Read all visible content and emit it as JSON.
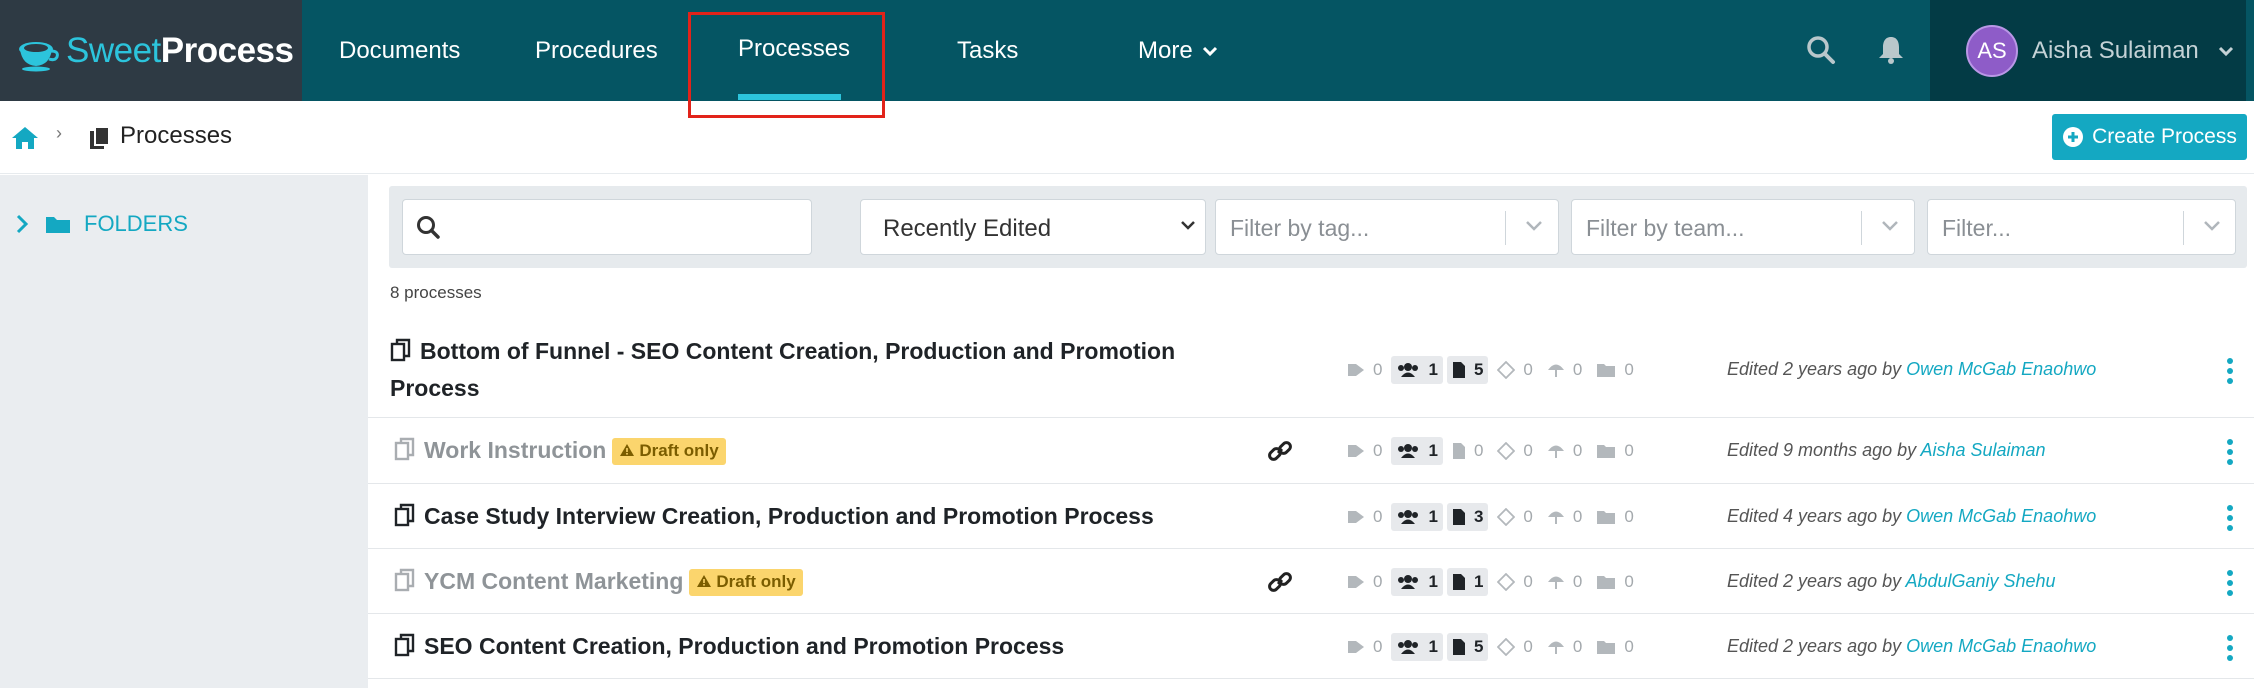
{
  "brand": {
    "sweet": "Sweet",
    "process": "Process"
  },
  "nav": {
    "documents": "Documents",
    "procedures": "Procedures",
    "processes": "Processes",
    "tasks": "Tasks",
    "more": "More"
  },
  "user": {
    "initials": "AS",
    "name": "Aisha Sulaiman"
  },
  "breadcrumb": {
    "current": "Processes"
  },
  "actions": {
    "create_process": "Create Process"
  },
  "sidebar": {
    "folders_label": "FOLDERS"
  },
  "filters": {
    "search_placeholder": "",
    "sort_value": "Recently Edited",
    "tag_placeholder": "Filter by tag...",
    "team_placeholder": "Filter by team...",
    "generic_placeholder": "Filter..."
  },
  "list": {
    "count_text": "8 processes",
    "draft_label": "Draft only",
    "rows": [
      {
        "title": "Bottom of Funnel - SEO Content Creation, Production and Promotion Process",
        "draft": false,
        "stats": {
          "tags": "0",
          "members": "1",
          "docs": "5",
          "approvals": "0",
          "uploads": "0",
          "folders": "0"
        },
        "edited_prefix": "Edited 2 years ago by ",
        "editor": "Owen McGab Enaohwo"
      },
      {
        "title": "Work Instruction",
        "draft": true,
        "stats": {
          "tags": "0",
          "members": "1",
          "docs": "0",
          "approvals": "0",
          "uploads": "0",
          "folders": "0"
        },
        "edited_prefix": "Edited 9 months ago by ",
        "editor": "Aisha Sulaiman"
      },
      {
        "title": "Case Study Interview Creation, Production and Promotion Process",
        "draft": false,
        "stats": {
          "tags": "0",
          "members": "1",
          "docs": "3",
          "approvals": "0",
          "uploads": "0",
          "folders": "0"
        },
        "edited_prefix": "Edited 4 years ago by ",
        "editor": "Owen McGab Enaohwo"
      },
      {
        "title": "YCM Content Marketing",
        "draft": true,
        "stats": {
          "tags": "0",
          "members": "1",
          "docs": "1",
          "approvals": "0",
          "uploads": "0",
          "folders": "0"
        },
        "edited_prefix": "Edited 2 years ago by ",
        "editor": "AbdulGaniy Shehu"
      },
      {
        "title": "SEO Content Creation, Production and Promotion Process",
        "draft": false,
        "stats": {
          "tags": "0",
          "members": "1",
          "docs": "5",
          "approvals": "0",
          "uploads": "0",
          "folders": "0"
        },
        "edited_prefix": "Edited 2 years ago by ",
        "editor": "Owen McGab Enaohwo"
      }
    ]
  },
  "colors": {
    "nav_bg": "#055563",
    "accent": "#14a8c2",
    "draft_badge": "#fbd56d",
    "highlight": "#e2231a"
  }
}
